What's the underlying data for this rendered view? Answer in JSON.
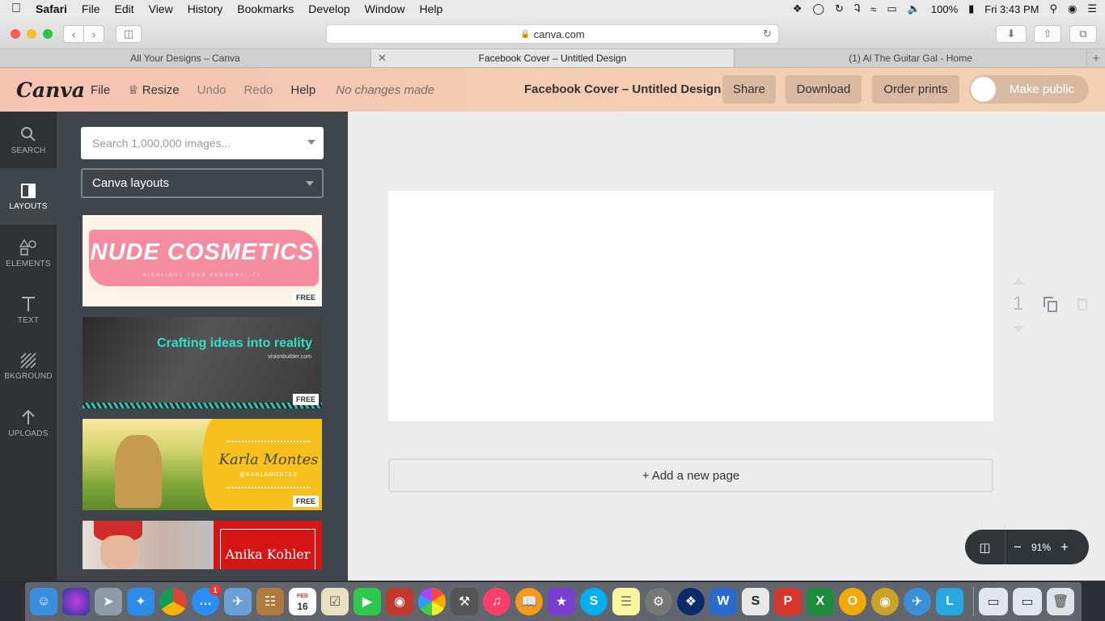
{
  "menubar": {
    "apple": "",
    "items": [
      "Safari",
      "File",
      "Edit",
      "View",
      "History",
      "Bookmarks",
      "Develop",
      "Window",
      "Help"
    ],
    "battery": "100%",
    "clock": "Fri 3:43 PM"
  },
  "browser": {
    "url": "canva.com",
    "tabs": [
      {
        "label": "All Your Designs – Canva"
      },
      {
        "label": "Facebook Cover – Untitled Design",
        "active": true
      },
      {
        "label": "(1) Al The Guitar Gal - Home"
      }
    ]
  },
  "canva": {
    "logo": "Canva",
    "menu": {
      "file": "File",
      "resize": "Resize",
      "undo": "Undo",
      "redo": "Redo",
      "help": "Help"
    },
    "status": "No changes made",
    "title": "Facebook Cover – Untitled Design",
    "share": "Share",
    "download": "Download",
    "order_prints": "Order prints",
    "make_public": "Make public"
  },
  "rail": [
    {
      "label": "SEARCH",
      "icon": "search-icon"
    },
    {
      "label": "LAYOUTS",
      "icon": "layouts-icon",
      "active": true
    },
    {
      "label": "ELEMENTS",
      "icon": "shapes-icon"
    },
    {
      "label": "TEXT",
      "icon": "text-icon"
    },
    {
      "label": "BKGROUND",
      "icon": "background-icon"
    },
    {
      "label": "UPLOADS",
      "icon": "upload-arrow-icon"
    }
  ],
  "panel": {
    "search_placeholder": "Search 1,000,000 images...",
    "dropdown": "Canva layouts",
    "free_label": "FREE",
    "templates": [
      {
        "title": "NUDE COSMETICS",
        "subtitle": "HIGHLIGHT YOUR PERSONALITY"
      },
      {
        "title": "Crafting ideas into reality",
        "subtitle": "visionbuilder.com"
      },
      {
        "title": "Karla Montes",
        "subtitle": "@KARLAMONTES"
      },
      {
        "title": "Anika Kohler"
      }
    ]
  },
  "canvas": {
    "page_number": "1",
    "add_page": "+ Add a new page",
    "zoom": "91%"
  },
  "dock": {
    "calendar_month": "FEB",
    "calendar_day": "16",
    "messages_badge": "1"
  },
  "colors": {
    "header_gradient_start": "#f5c3b2",
    "header_button": "#d9b9a0",
    "rail_bg": "#2d3337",
    "panel_bg": "#3e464b"
  }
}
